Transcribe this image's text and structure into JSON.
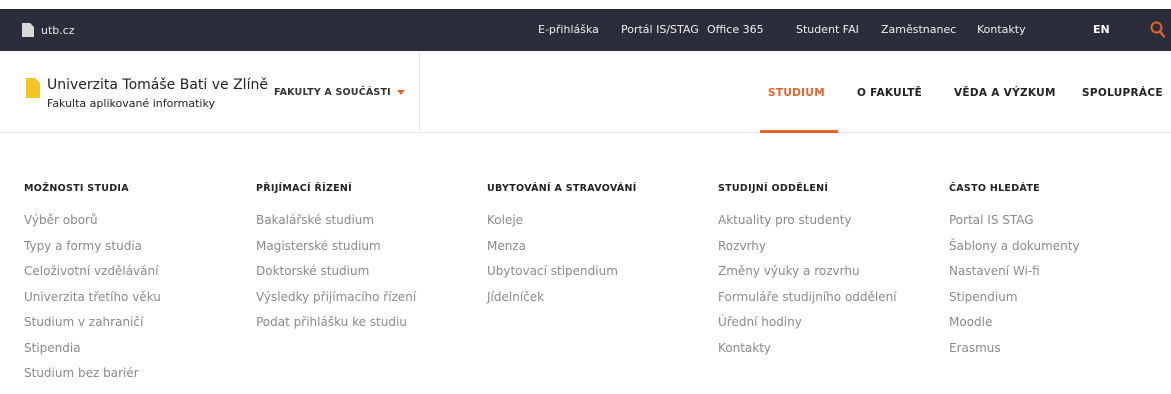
{
  "topbar": {
    "domain": "utb.cz",
    "links": [
      "E-přihláška",
      "Portál IS/STAG",
      "Office 365",
      "Student FAI",
      "Zaměstnanec",
      "Kontakty"
    ],
    "lang": "EN",
    "search_icon": "search-icon"
  },
  "header": {
    "university": "Univerzita Tomáše Bati ve Zlíně",
    "faculty": "Fakulta aplikované informatiky",
    "faculties_menu": "FAKULTY A SOUČÁSTI",
    "nav": [
      "STUDIUM",
      "O FAKULTĚ",
      "VĚDA A VÝZKUM",
      "SPOLUPRÁCE"
    ],
    "active_nav": "STUDIUM"
  },
  "colors": {
    "accent": "#e8632a",
    "topbar_bg": "#2b2e3a",
    "logo_yellow": "#f3c623"
  },
  "menu": {
    "columns": [
      {
        "title": "MOŽNOSTI STUDIA",
        "items": [
          "Výběr oborů",
          "Typy a formy studia",
          "Celoživotní vzdělávání",
          "Univerzita třetího věku",
          "Studium v zahraničí",
          "Stipendia",
          "Studium bez bariér"
        ]
      },
      {
        "title": "PŘIJÍMACÍ ŘÍZENÍ",
        "items": [
          "Bakalářské studium",
          "Magisterské studium",
          "Doktorské studium",
          "Výsledky přijímacího řízení",
          "Podat přihlášku ke studiu"
        ]
      },
      {
        "title": "UBYTOVÁNÍ A STRAVOVÁNÍ",
        "items": [
          "Koleje",
          "Menza",
          "Ubytovací stipendium",
          "Jídelníček"
        ]
      },
      {
        "title": "STUDIJNÍ ODDĚLENÍ",
        "items": [
          "Aktuality pro studenty",
          "Rozvrhy",
          "Změny výuky a rozvrhu",
          "Formuláře studijního oddělení",
          "Úřední hodiny",
          "Kontakty"
        ]
      },
      {
        "title": "ČASTO HLEDÁTE",
        "items": [
          "Portal IS STAG",
          "Šablony a dokumenty",
          "Nastavení Wi-fi",
          "Stipendium",
          "Moodle",
          "Erasmus"
        ]
      }
    ]
  }
}
